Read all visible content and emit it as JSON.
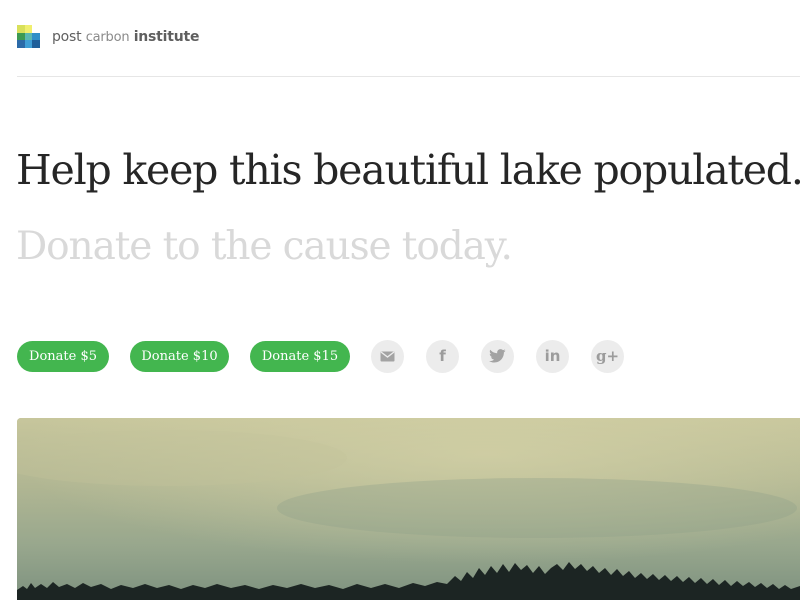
{
  "brand": {
    "name_part1": "post",
    "name_part2": "carbon",
    "name_part3": "institute",
    "logo_colors": [
      "#d8e05a",
      "#f0ef6e",
      "#b7d65b",
      "#3d9a52",
      "#5ab8b0",
      "#2f8fc8",
      "#2b6aa8",
      "#3f9fd6",
      "#1f5f9a"
    ]
  },
  "hero_text": {
    "headline": "Help keep this beautiful lake populated.",
    "subhead": "Donate to the cause today."
  },
  "donate": {
    "buttons": [
      {
        "label": "Donate $5"
      },
      {
        "label": "Donate $10"
      },
      {
        "label": "Donate $15"
      }
    ],
    "accent_color": "#43b64f"
  },
  "share": {
    "icons": [
      "email-icon",
      "facebook-icon",
      "twitter-icon",
      "linkedin-icon",
      "google-plus-icon"
    ],
    "linkedin_text": "in",
    "facebook_text": "f",
    "gplus_text": "g+"
  },
  "hero_image": {
    "subject": "lake-forest-photo"
  }
}
